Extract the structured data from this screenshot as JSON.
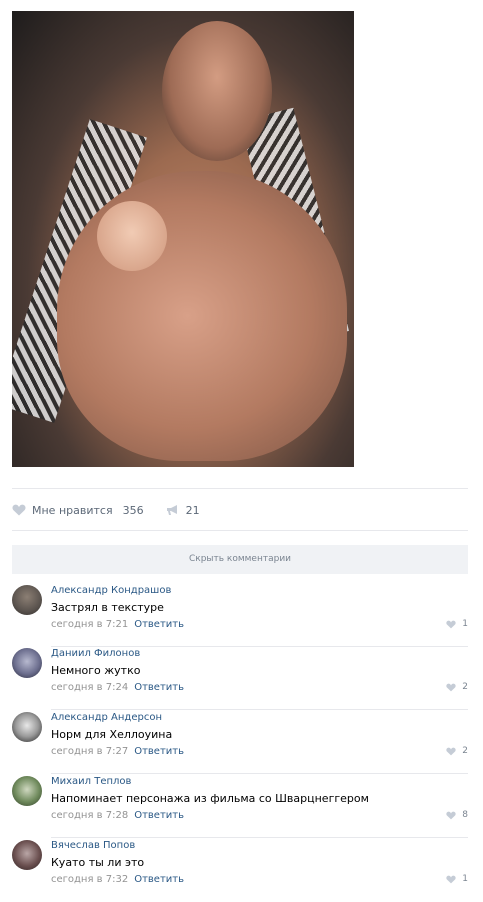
{
  "post": {
    "likes_label": "Мне нравится",
    "likes_count": "356",
    "reposts_count": "21"
  },
  "comments_bar": {
    "hide_label": "Скрыть комментарии"
  },
  "comments": [
    {
      "author": "Александр Кондрашов",
      "text": "Застрял в текстуре",
      "date": "сегодня в 7:21",
      "reply": "Ответить",
      "likes": "1"
    },
    {
      "author": "Даниил Филонов",
      "text": "Немного жутко",
      "date": "сегодня в 7:24",
      "reply": "Ответить",
      "likes": "2"
    },
    {
      "author": "Александр Андерсон",
      "text": "Норм для Хеллоуина",
      "date": "сегодня в 7:27",
      "reply": "Ответить",
      "likes": "2"
    },
    {
      "author": "Михаил Теплов",
      "text": "Напоминает персонажа из фильма со Шварцнеггером",
      "date": "сегодня в 7:28",
      "reply": "Ответить",
      "likes": "8"
    },
    {
      "author": "Вячеслав Попов",
      "text": "Куато ты ли это",
      "date": "сегодня в 7:32",
      "reply": "Ответить",
      "likes": "1"
    }
  ],
  "icons": {
    "like": "heart-icon",
    "repost": "megaphone-icon"
  },
  "colors": {
    "link": "#2a5885",
    "meta": "#939393",
    "bar_bg": "#f0f2f5",
    "separator": "#e7e8ec"
  }
}
